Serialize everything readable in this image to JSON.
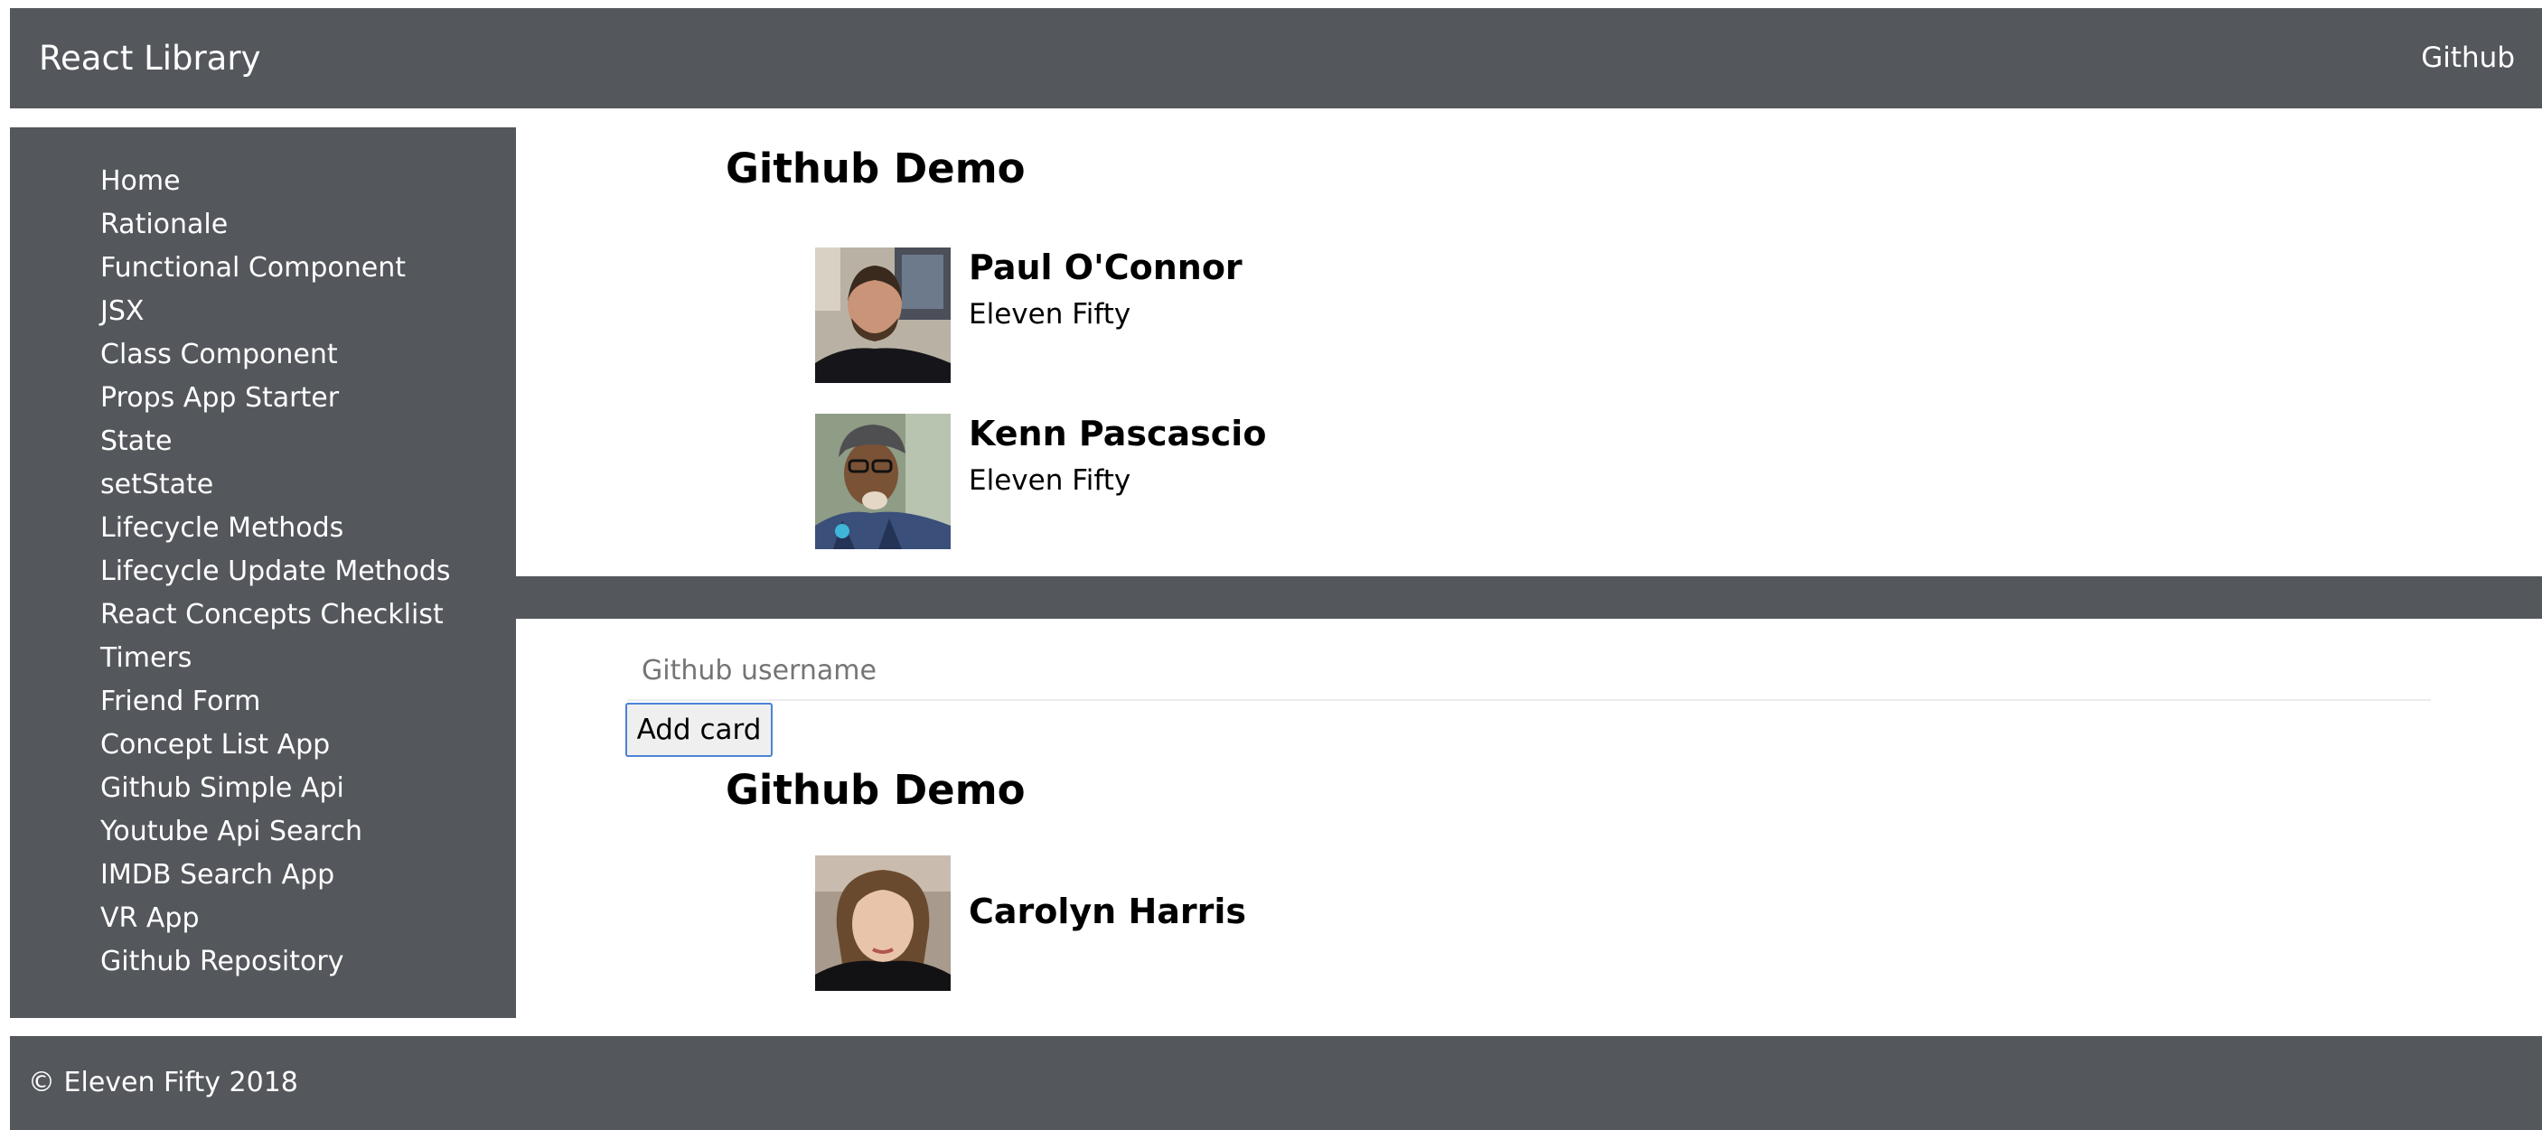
{
  "navbar": {
    "brand": "React Library",
    "github_link": "Github"
  },
  "sidebar": {
    "items": [
      {
        "label": "Home"
      },
      {
        "label": "Rationale"
      },
      {
        "label": "Functional Component"
      },
      {
        "label": "JSX"
      },
      {
        "label": "Class Component"
      },
      {
        "label": "Props App Starter"
      },
      {
        "label": "State"
      },
      {
        "label": "setState"
      },
      {
        "label": "Lifecycle Methods"
      },
      {
        "label": "Lifecycle Update Methods"
      },
      {
        "label": "React Concepts Checklist"
      },
      {
        "label": "Timers"
      },
      {
        "label": "Friend Form"
      },
      {
        "label": "Concept List App"
      },
      {
        "label": "Github Simple Api"
      },
      {
        "label": "Youtube Api Search"
      },
      {
        "label": "IMDB Search App"
      },
      {
        "label": "VR App"
      },
      {
        "label": "Github Repository"
      }
    ]
  },
  "demo1": {
    "title": "Github Demo",
    "cards": [
      {
        "name": "Paul O'Connor",
        "company": "Eleven Fifty"
      },
      {
        "name": "Kenn Pascascio",
        "company": "Eleven Fifty"
      }
    ]
  },
  "form": {
    "placeholder": "Github username",
    "value": "",
    "button_label": "Add card"
  },
  "demo2": {
    "title": "Github Demo",
    "cards": [
      {
        "name": "Carolyn Harris",
        "company": ""
      }
    ]
  },
  "footer": {
    "text": "© Eleven Fifty 2018"
  }
}
